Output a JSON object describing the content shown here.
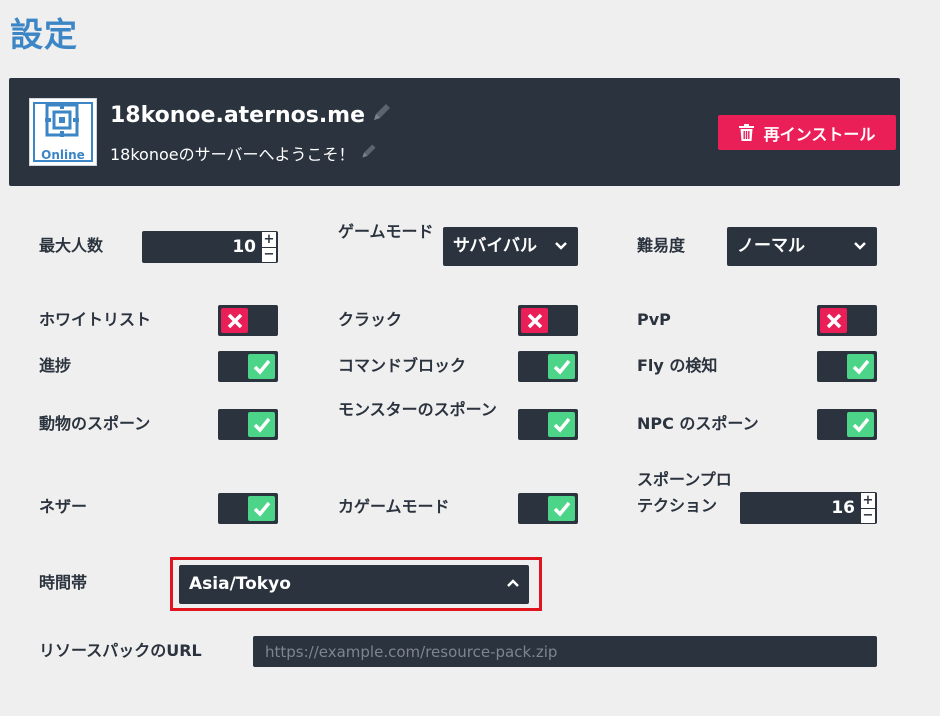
{
  "page": {
    "title": "設定"
  },
  "server": {
    "status": "Online",
    "address": "18konoe.aternos.me",
    "motd": "18konoeのサーバーへようこそ！",
    "reinstall_label": "再インストール"
  },
  "settings": {
    "max_players": {
      "label": "最大人数",
      "value": "10"
    },
    "gamemode": {
      "label": "ゲームモード",
      "value": "サバイバル"
    },
    "difficulty": {
      "label": "難易度",
      "value": "ノーマル"
    },
    "whitelist": {
      "label": "ホワイトリスト",
      "enabled": false
    },
    "cracked": {
      "label": "クラック",
      "enabled": false
    },
    "pvp": {
      "label": "PvP",
      "enabled": false
    },
    "advancements": {
      "label": "進捗",
      "enabled": true
    },
    "command_blocks": {
      "label": "コマンドブロック",
      "enabled": true
    },
    "fly_detection": {
      "label": "Fly の検知",
      "enabled": true
    },
    "spawn_animals": {
      "label": "動物のスポーン",
      "enabled": true
    },
    "spawn_monsters": {
      "label": "モンスターのスポーン",
      "enabled": true
    },
    "spawn_npcs": {
      "label": "NPC のスポーン",
      "enabled": true
    },
    "nether": {
      "label": "ネザー",
      "enabled": true
    },
    "force_gamemode": {
      "label": "カゲームモード",
      "enabled": true
    },
    "spawn_protection": {
      "label": "スポーンプロテクション",
      "value": "16"
    },
    "timezone": {
      "label": "時間帯",
      "value": "Asia/Tokyo"
    },
    "resource_pack": {
      "label": "リソースパックのURL",
      "placeholder": "https://example.com/resource-pack.zip",
      "value": ""
    }
  },
  "colors": {
    "accent": "#3d86c6",
    "dark": "#2b333e",
    "danger": "#ea1f58",
    "success": "#4cd488",
    "highlight": "#e0141e"
  }
}
